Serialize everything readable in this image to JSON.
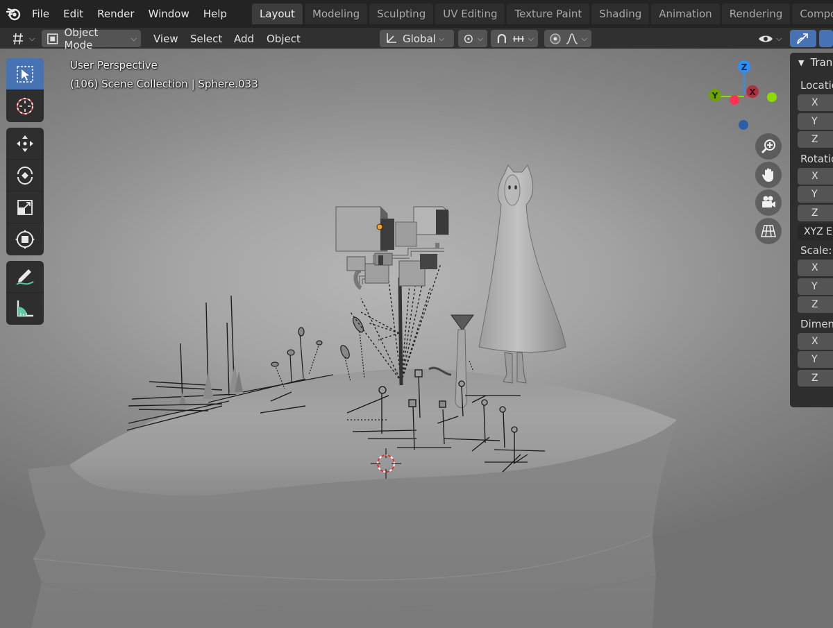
{
  "menu": [
    "File",
    "Edit",
    "Render",
    "Window",
    "Help"
  ],
  "workspaces": {
    "active": "Layout",
    "tabs": [
      "Layout",
      "Modeling",
      "Sculpting",
      "UV Editing",
      "Texture Paint",
      "Shading",
      "Animation",
      "Rendering",
      "Compositing"
    ]
  },
  "header": {
    "mode": "Object Mode",
    "view": "View",
    "select": "Select",
    "add": "Add",
    "object": "Object",
    "orientation": "Global"
  },
  "viewport": {
    "perspective_label": "User Perspective",
    "collection_label": "(106) Scene Collection | Sphere.033"
  },
  "gizmo": {
    "z": "Z",
    "y": "Y",
    "x": "X"
  },
  "npanel": {
    "section": "Transform",
    "location_label": "Location:",
    "rotation_label": "Rotation:",
    "rotation_mode": "XYZ Euler",
    "scale_label": "Scale:",
    "dimensions_label": "Dimensions:",
    "axes": [
      "X",
      "Y",
      "Z"
    ]
  },
  "colors": {
    "accent": "#4772b3",
    "axis_x": "#ff3352",
    "axis_y": "#8bdc00",
    "axis_z": "#2890ff",
    "selection_origin": "#ffa033"
  }
}
